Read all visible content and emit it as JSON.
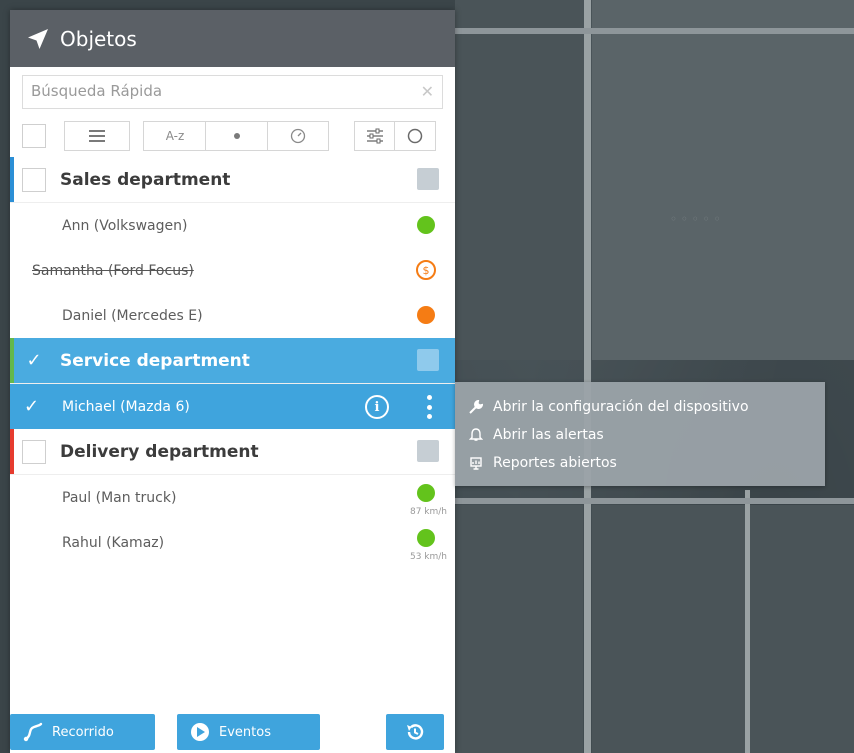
{
  "panel": {
    "title": "Objetos",
    "icon": "navigation-arrow-icon"
  },
  "search": {
    "placeholder": "Búsqueda Rápida",
    "value": ""
  },
  "toolbar": {
    "sort_az_label": "A-z"
  },
  "groups": [
    {
      "name": "Sales department",
      "stripe_color": "#2b8fd6",
      "checked": false,
      "items": [
        {
          "name": "Ann (Volkswagen)",
          "status": "green"
        },
        {
          "name": "Samantha (Ford Focus)",
          "status": "orange-ring",
          "status_text": "$",
          "struck": true
        },
        {
          "name": "Daniel (Mercedes E)",
          "status": "orange"
        }
      ]
    },
    {
      "name": "Service department",
      "stripe_color": "#63b84c",
      "checked": true,
      "items": [
        {
          "name": "Michael (Mazda 6)",
          "selected": true,
          "info": "i"
        }
      ]
    },
    {
      "name": "Delivery department",
      "stripe_color": "#e63b2e",
      "checked": false,
      "items": [
        {
          "name": "Paul (Man truck)",
          "status": "green",
          "speed": "87 km/h"
        },
        {
          "name": "Rahul (Kamaz)",
          "status": "green",
          "speed": "53 km/h"
        }
      ]
    }
  ],
  "bottom": {
    "route_label": "Recorrido",
    "events_label": "Eventos"
  },
  "context_menu": {
    "items": [
      {
        "label": "Abrir la configuración del dispositivo",
        "icon": "wrench-icon"
      },
      {
        "label": "Abrir las alertas",
        "icon": "bell-icon"
      },
      {
        "label": "Reportes abiertos",
        "icon": "report-icon"
      }
    ]
  },
  "colors": {
    "accent": "#3fa4dd",
    "header": "#5b6066",
    "green": "#63c31c",
    "orange": "#f57c14"
  }
}
